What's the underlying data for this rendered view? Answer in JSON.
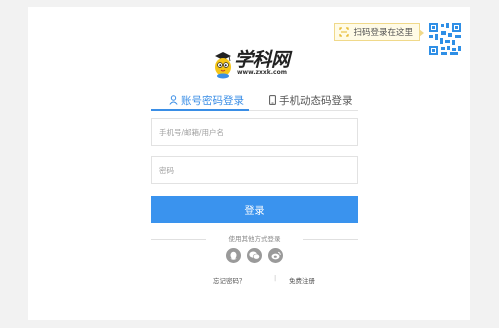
{
  "qr_hint": {
    "text": "扫码登录在这里"
  },
  "logo": {
    "brand": "学科网",
    "url": "www.zxxk.com"
  },
  "tabs": [
    {
      "label": "账号密码登录",
      "icon": "user-icon",
      "active": true
    },
    {
      "label": "手机动态码登录",
      "icon": "phone-icon",
      "active": false
    }
  ],
  "form": {
    "account_placeholder": "手机号/邮箱/用户名",
    "account_value": "",
    "password_placeholder": "密码",
    "password_value": "",
    "login_label": "登录"
  },
  "other_login": {
    "label": "使用其他方式登录",
    "methods": [
      "qq-icon",
      "wechat-icon",
      "weibo-icon"
    ]
  },
  "links": {
    "forgot": "忘记密码？",
    "separator": "|",
    "register": "免费注册"
  },
  "colors": {
    "accent": "#3a8ee6",
    "button": "#3a93ee",
    "qr": "#2f8fe6",
    "hint_bg": "#fffbe6"
  }
}
